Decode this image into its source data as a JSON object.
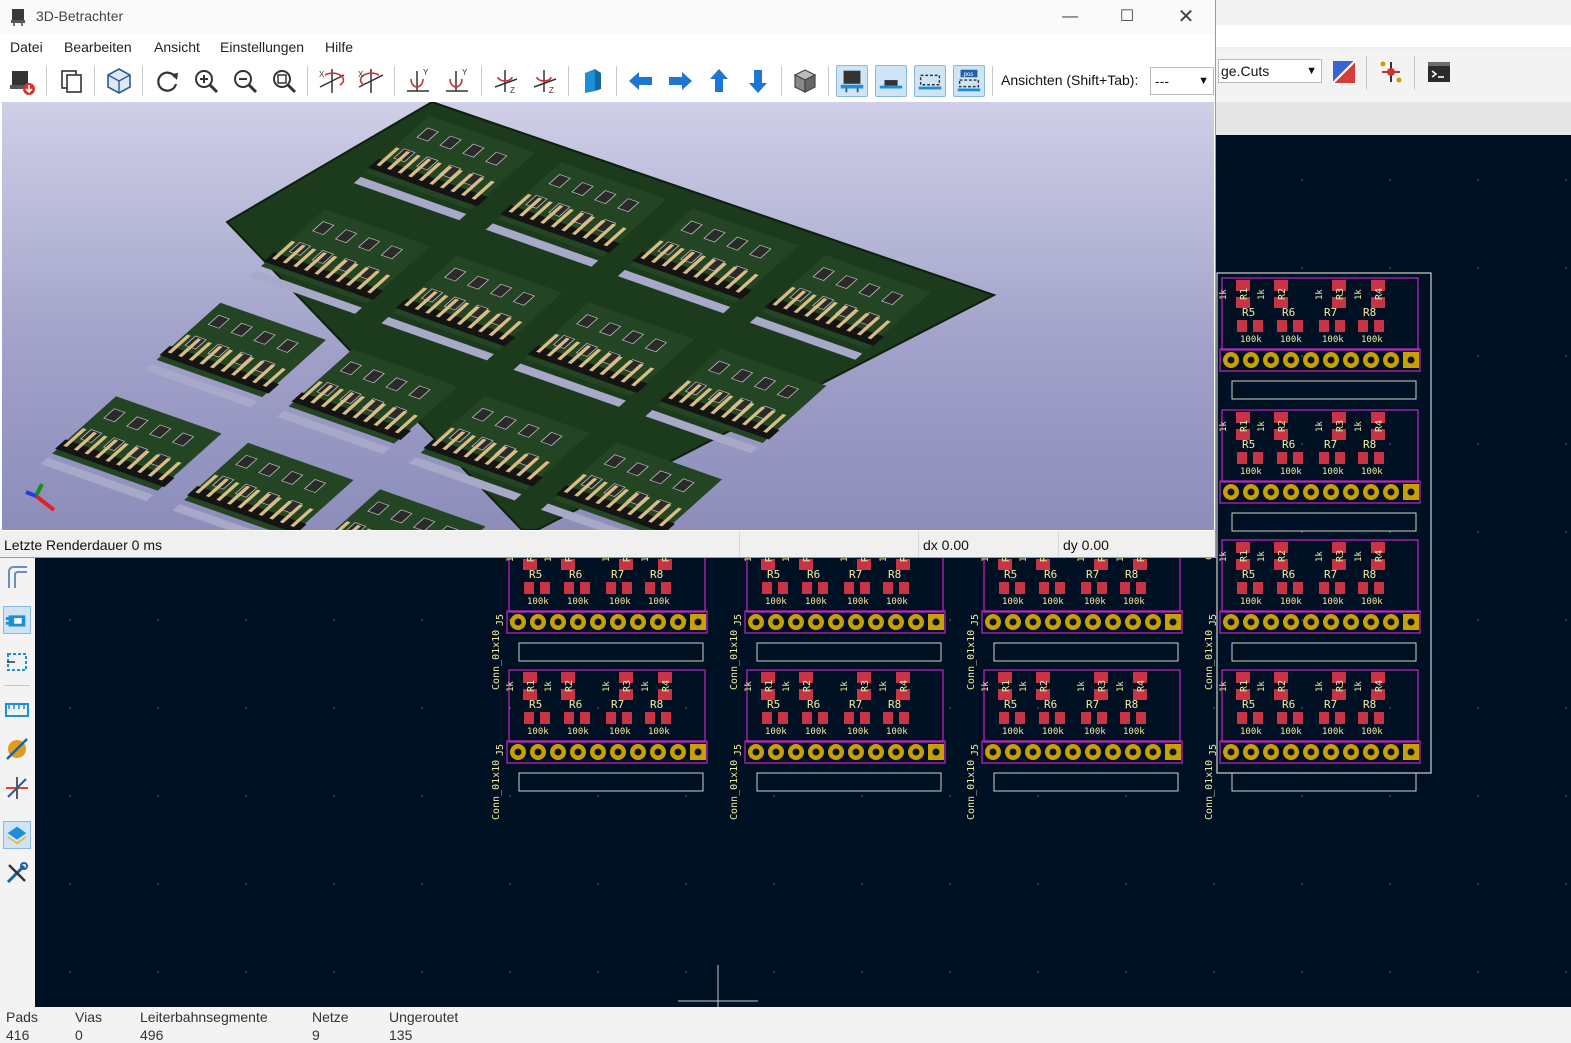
{
  "viewer": {
    "title": "3D-Betrachter",
    "menu": [
      "Datei",
      "Bearbeiten",
      "Ansicht",
      "Einstellungen",
      "Hilfe"
    ],
    "views_label": "Ansichten (Shift+Tab):",
    "views_value": "---",
    "status": {
      "render": "Letzte Renderdauer 0 ms",
      "dx": "dx 0.00",
      "dy": "dy 0.00"
    }
  },
  "editor": {
    "layer_select": "ge.Cuts",
    "status_columns": [
      {
        "label": "Pads",
        "value": "416"
      },
      {
        "label": "Vias",
        "value": "0"
      },
      {
        "label": "Leiterbahnsegmente",
        "value": "496"
      },
      {
        "label": "Netze",
        "value": "9"
      },
      {
        "label": "Ungeroutet",
        "value": "135"
      }
    ]
  },
  "pcb_labels": {
    "r_top": [
      "R1",
      "R2",
      "R3",
      "R4"
    ],
    "r_bottom": [
      "R5",
      "R6",
      "R7",
      "R8"
    ],
    "conn": "Conn_01x10",
    "j": "J5",
    "val_top": "1k",
    "val_bottom": "100k"
  },
  "colors": {
    "canvas_bg": "#001023",
    "board_edge": "#d0d2cd",
    "pad_ring": "#c8a000",
    "smd_pad": "#c83445",
    "silk": "#f2eda1",
    "courtyard": "#c226c4",
    "pcb_green": "#1c3a1c"
  }
}
